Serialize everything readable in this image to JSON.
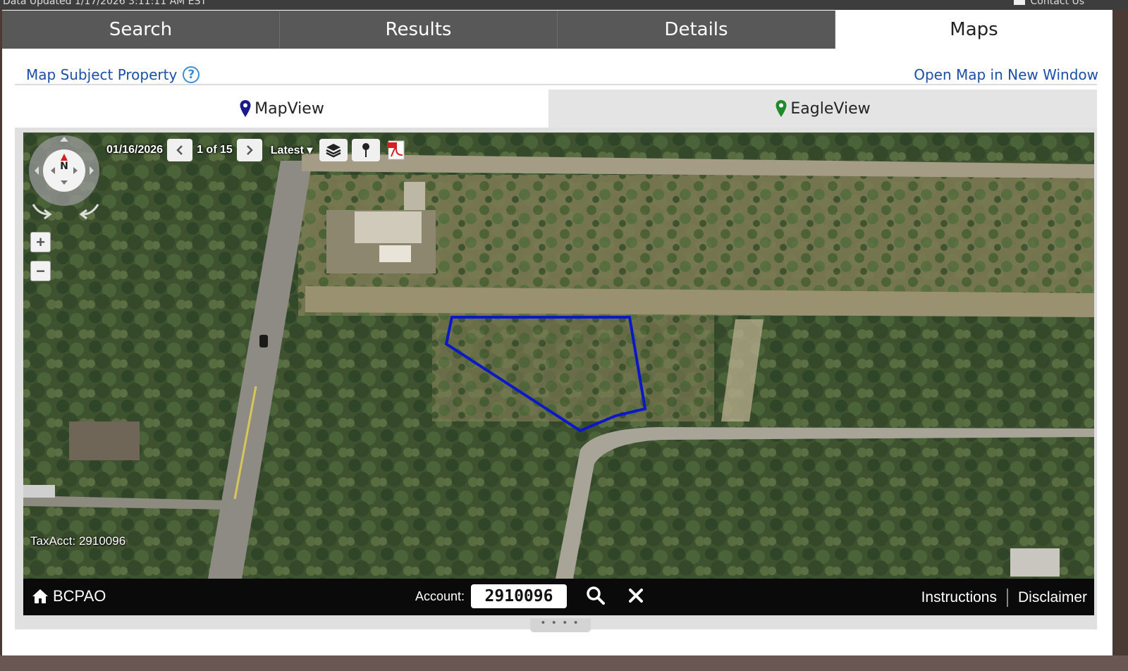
{
  "top_strip": {
    "left_text": "Data Updated 1/17/2026 3:11:11 AM EST",
    "right_text": "Contact Us"
  },
  "tabs": [
    {
      "label": "Search"
    },
    {
      "label": "Results"
    },
    {
      "label": "Details"
    },
    {
      "label": "Maps",
      "active": true
    }
  ],
  "map_subject": {
    "label": "Map Subject Property",
    "help": "?"
  },
  "open_map_link": "Open Map in New Window",
  "view_tabs": [
    {
      "label": "MapView",
      "pin_color": "#1a1a8c"
    },
    {
      "label": "EagleView",
      "pin_color": "#1f8a2a"
    }
  ],
  "map": {
    "date": "01/16/2026",
    "page": "1 of 15",
    "version": "Latest",
    "zoom_in": "+",
    "zoom_out": "−",
    "compass_label": "N",
    "tax_acct": "TaxAcct: 2910096",
    "parcel_color": "#0b18c8"
  },
  "bottom_bar": {
    "brand": "BCPAO",
    "account_label": "Account:",
    "account_value": "2910096",
    "instructions": "Instructions",
    "disclaimer": "Disclaimer"
  },
  "handle": "• • • •"
}
